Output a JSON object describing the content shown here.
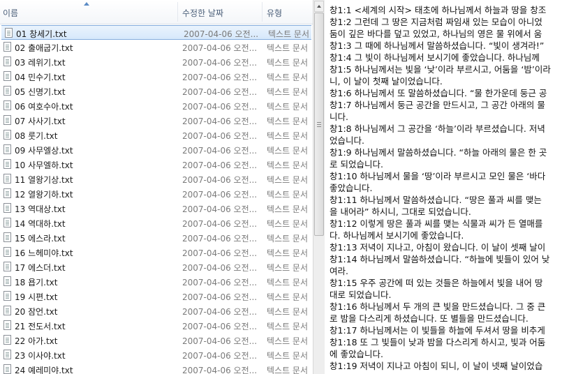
{
  "columns": {
    "name": "이름",
    "modified": "수정한 날짜",
    "type": "유형"
  },
  "files": [
    {
      "name": "01 창세기.txt",
      "date": "2007-04-06 오전...",
      "type": "텍스트 문서",
      "selected": true
    },
    {
      "name": "02 출애굽기.txt",
      "date": "2007-04-06 오전...",
      "type": "텍스트 문서"
    },
    {
      "name": "03 레위기.txt",
      "date": "2007-04-06 오전...",
      "type": "텍스트 문서"
    },
    {
      "name": "04 민수기.txt",
      "date": "2007-04-06 오전...",
      "type": "텍스트 문서"
    },
    {
      "name": "05 신명기.txt",
      "date": "2007-04-06 오전...",
      "type": "텍스트 문서"
    },
    {
      "name": "06 여호수아.txt",
      "date": "2007-04-06 오전...",
      "type": "텍스트 문서"
    },
    {
      "name": "07 사사기.txt",
      "date": "2007-04-06 오전...",
      "type": "텍스트 문서"
    },
    {
      "name": "08 룻기.txt",
      "date": "2007-04-06 오전...",
      "type": "텍스트 문서"
    },
    {
      "name": "09 사무엘상.txt",
      "date": "2007-04-06 오전...",
      "type": "텍스트 문서"
    },
    {
      "name": "10 사무엘하.txt",
      "date": "2007-04-06 오전...",
      "type": "텍스트 문서"
    },
    {
      "name": "11 열왕기상.txt",
      "date": "2007-04-06 오전...",
      "type": "텍스트 문서"
    },
    {
      "name": "12 열왕기하.txt",
      "date": "2007-04-06 오전...",
      "type": "텍스트 문서"
    },
    {
      "name": "13 역대상.txt",
      "date": "2007-04-06 오전...",
      "type": "텍스트 문서"
    },
    {
      "name": "14 역대하.txt",
      "date": "2007-04-06 오전...",
      "type": "텍스트 문서"
    },
    {
      "name": "15 에스라.txt",
      "date": "2007-04-06 오전...",
      "type": "텍스트 문서"
    },
    {
      "name": "16 느헤미야.txt",
      "date": "2007-04-06 오전...",
      "type": "텍스트 문서"
    },
    {
      "name": "17 에스더.txt",
      "date": "2007-04-06 오전...",
      "type": "텍스트 문서"
    },
    {
      "name": "18 욥기.txt",
      "date": "2007-04-06 오전...",
      "type": "텍스트 문서"
    },
    {
      "name": "19 시편.txt",
      "date": "2007-04-06 오전...",
      "type": "텍스트 문서"
    },
    {
      "name": "20 잠언.txt",
      "date": "2007-04-06 오전...",
      "type": "텍스트 문서"
    },
    {
      "name": "21 전도서.txt",
      "date": "2007-04-06 오전...",
      "type": "텍스트 문서"
    },
    {
      "name": "22 아가.txt",
      "date": "2007-04-06 오전...",
      "type": "텍스트 문서"
    },
    {
      "name": "23 이사야.txt",
      "date": "2007-04-06 오전...",
      "type": "텍스트 문서"
    },
    {
      "name": "24 예레미야.txt",
      "date": "2007-04-06 오전...",
      "type": "텍스트 문서"
    }
  ],
  "preview_lines": [
    "창1:1 <세계의 시작> 태초에 하나님께서 하늘과 땅을 창조",
    "창1:2 그런데 그 땅은 지금처럼 짜임새 있는 모습이 아니었",
    "둠이 깊은 바다를 덮고 있었고, 하나님의 영은 물 위에서 움",
    "창1:3 그 때에 하나님께서 말씀하셨습니다. “빛이 생겨라!”",
    "창1:4 그 빛이 하나님께서 보시기에 좋았습니다. 하나님께",
    "창1:5 하나님께서는 빛을 ‘낮’이라 부르시고, 어둠을 ‘밤’이라",
    "니, 이 날이 첫째 날이었습니다.",
    "창1:6 하나님께서 또 말씀하셨습니다. “물 한가운데 둥근 공",
    "창1:7 하나님께서 둥근 공간을 만드시고, 그 공간 아래의 물",
    "니다.",
    "창1:8 하나님께서 그 공간을 ‘하늘’이라 부르셨습니다. 저녁",
    "었습니다.",
    "창1:9 하나님께서 말씀하셨습니다. “하늘 아래의 물은 한 곳",
    "로 되었습니다.",
    "창1:10 하나님께서 물을 ‘땅’이라 부르시고 모인 물은 ‘바다",
    "좋았습니다.",
    "창1:11 하나님께서 말씀하셨습니다. “땅은 풀과 씨를 맺는",
    "을 내어라” 하시니, 그대로 되었습니다.",
    "창1:12 이렇게 땅은 풀과 씨를 맺는 식물과 씨가 든 열매를",
    "다. 하나님께서 보시기에 좋았습니다.",
    "창1:13 저녁이 지나고, 아침이 왔습니다. 이 날이 셋째 날이",
    "창1:14 하나님께서 말씀하셨습니다. “하늘에 빛들이 있어 낮",
    "여라.",
    "창1:15 우주 공간에 떠 있는 것들은 하늘에서 빛을 내어 땅",
    "대로 되었습니다.",
    "창1:16 하나님께서 두 개의 큰 빛을 만드셨습니다. 그 중 큰",
    "로 밤을 다스리게 하셨습니다. 또 별들을 만드셨습니다.",
    "창1:17 하나님께서는 이 빛들을 하늘에 두셔서 땅을 비추게",
    "창1:18 또 그 빛들이 낮과 밤을 다스리게 하시고, 빛과 어둠",
    "에 좋았습니다.",
    "창1:19 저녁이 지나고 아침이 되니, 이 날이 넷째 날이었습"
  ]
}
